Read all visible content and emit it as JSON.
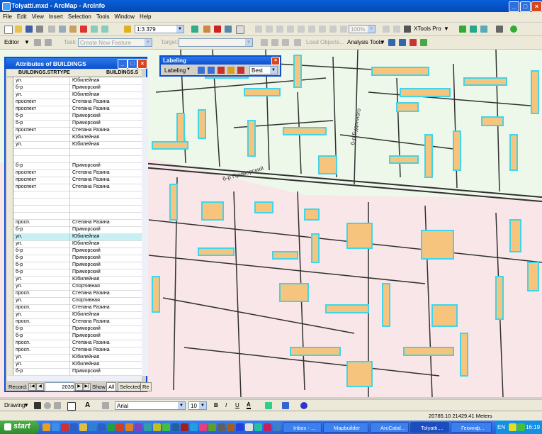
{
  "window": {
    "title": "Tolyatti.mxd - ArcMap - ArcInfo",
    "minimize": "_",
    "maximize": "□",
    "close": "×"
  },
  "menu": [
    "File",
    "Edit",
    "View",
    "Insert",
    "Selection",
    "Tools",
    "Window",
    "Help"
  ],
  "toolbar": {
    "scale": "1:3 379",
    "zoom_percent": "100%",
    "xtools": "XTools Pro",
    "editor": "Editor",
    "task_label": "Task:",
    "task_value": "Create New Feature",
    "target_label": "Target:",
    "load_objects": "Load Objects...",
    "analysis_tools": "Analysis Tools"
  },
  "attributes": {
    "title": "Attributes of BUILDINGS",
    "col1": "BUILDINGS.STRTYPE",
    "col2": "BUILDINGS.S",
    "rows": [
      [
        "ул.",
        "Юбилейная"
      ],
      [
        "б-р",
        "Приморский"
      ],
      [
        "ул.",
        "Юбилейная"
      ],
      [
        "проспект",
        "Степана Разина"
      ],
      [
        "проспект",
        "Степана Разина"
      ],
      [
        "б-р",
        "Приморский"
      ],
      [
        "б-р",
        "Приморский"
      ],
      [
        "проспект",
        "Степана Разина"
      ],
      [
        "ул.",
        "Юбилейная"
      ],
      [
        "ул.",
        "Юбилейная"
      ],
      [
        "",
        ""
      ],
      [
        "",
        ""
      ],
      [
        "б-р",
        "Приморский"
      ],
      [
        "проспект",
        "Степана Разина"
      ],
      [
        "проспект",
        "Степана Разина"
      ],
      [
        "проспект",
        "Степана Разина"
      ],
      [
        "",
        ""
      ],
      [
        "",
        ""
      ],
      [
        "",
        ""
      ],
      [
        "",
        ""
      ],
      [
        "просп.",
        "Степана Разина"
      ],
      [
        "б-р",
        "Приморский"
      ],
      [
        "ул.",
        "Юбилейная"
      ],
      [
        "ул.",
        "Юбилейная"
      ],
      [
        "б-р",
        "Приморский"
      ],
      [
        "б-р",
        "Приморский"
      ],
      [
        "б-р",
        "Приморский"
      ],
      [
        "б-р",
        "Приморский"
      ],
      [
        "ул.",
        "Юбилейная"
      ],
      [
        "ул.",
        "Спортивная"
      ],
      [
        "просп.",
        "Степана Разина"
      ],
      [
        "ул.",
        "Спортивная"
      ],
      [
        "просп.",
        "Степана Разина"
      ],
      [
        "ул.",
        "Юбилейная"
      ],
      [
        "просп.",
        "Степана Разина"
      ],
      [
        "б-р",
        "Приморский"
      ],
      [
        "б-р",
        "Приморский"
      ],
      [
        "просп.",
        "Степана Разина"
      ],
      [
        "просп.",
        "Степана Разина"
      ],
      [
        "ул.",
        "Юбилейная"
      ],
      [
        "ул.",
        "Юбилейная"
      ],
      [
        "б-р",
        "Приморский"
      ]
    ],
    "highlight_row": 22,
    "record_label": "Record:",
    "record_value": "2039",
    "show_label": "Show:",
    "all_tab": "All",
    "selected_tab": "Selected",
    "records_tab": "Re"
  },
  "labeling": {
    "title": "Labeling",
    "menu": "Labeling",
    "mode": "Best"
  },
  "map_labels": {
    "street1": "б-р Приморский",
    "street2": "б-р Буденного"
  },
  "drawing": {
    "drawing_menu": "Drawing",
    "font": "Arial",
    "size": "10",
    "bold": "B",
    "italic": "I",
    "underline": "U",
    "font_color": "A"
  },
  "status": {
    "coords": "20785.10  21429.41 Meters"
  },
  "taskbar": {
    "start": "start",
    "items": [
      "Inbox - ...",
      "Mapbuilder",
      "ArcCatal...",
      "Tolyatti....",
      "Геоинф..."
    ],
    "active_index": 3,
    "lang": "EN",
    "time": "16:19"
  },
  "colors": {
    "building": "#f7c47e",
    "building_outline": "#3ed6e8",
    "zone_green": "#eef8ea",
    "zone_pink": "#f9e6e8",
    "road": "#303030"
  }
}
